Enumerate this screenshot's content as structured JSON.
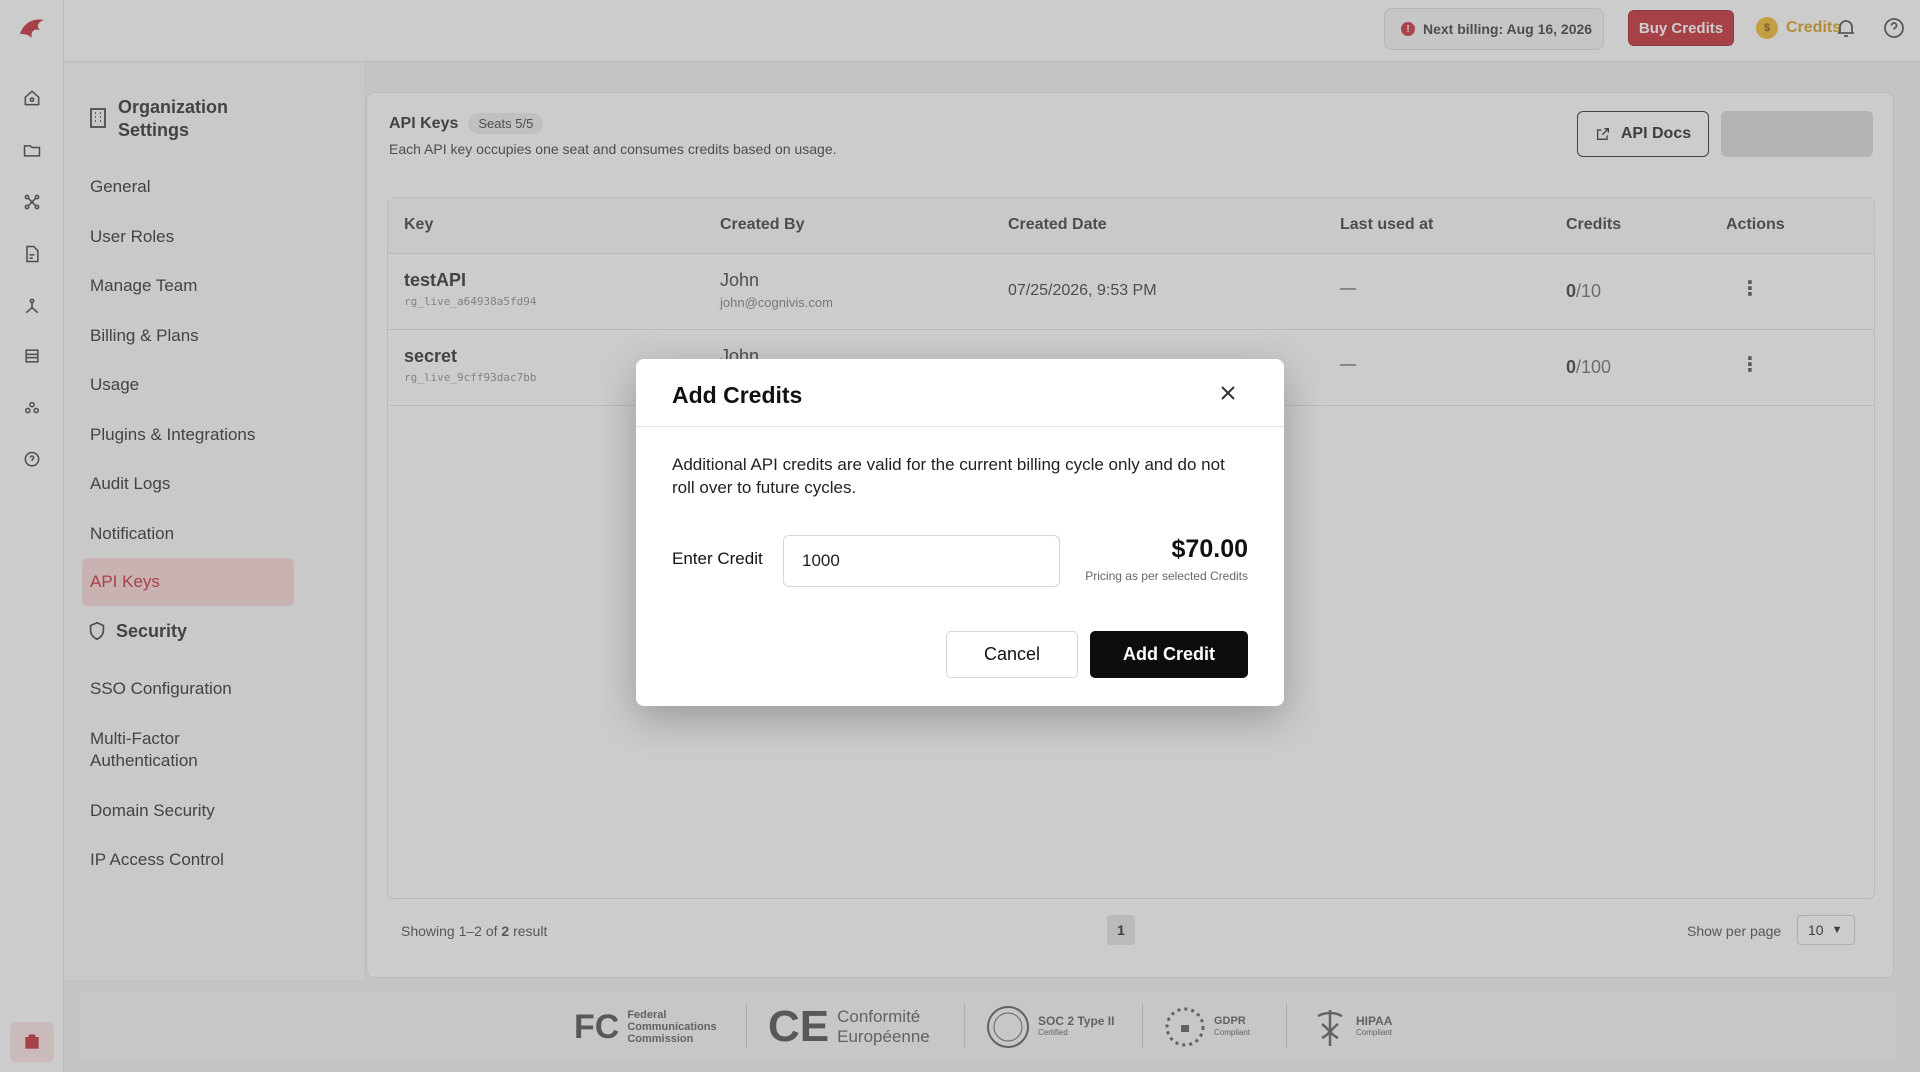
{
  "topbar": {
    "billing": "Next billing: Aug 16, 2026",
    "buy_credits": "Buy Credits",
    "credits": "Credits",
    "icons": [
      "bell-icon",
      "help-icon"
    ]
  },
  "settings_nav": {
    "title": "Organization Settings",
    "items": [
      "General",
      "User Roles",
      "Manage Team",
      "Billing & Plans",
      "Usage",
      "Plugins & Integrations",
      "Audit Logs",
      "Notification",
      "API Keys"
    ],
    "active": "API Keys",
    "security_title": "Security",
    "security_items": [
      "SSO Configuration",
      "Multi-Factor Authentication",
      "Domain Security",
      "IP Access Control"
    ]
  },
  "main": {
    "title": "API Keys",
    "seats": "Seats 5/5",
    "subtitle": "Each API key occupies one seat and consumes credits based on usage.",
    "docs_button": "API Docs",
    "columns": [
      "Key",
      "Created By",
      "Created Date",
      "Last used at",
      "Credits",
      "Actions"
    ],
    "rows": [
      {
        "name": "testAPI",
        "id": "rg_live_a64938a5fd94",
        "creator": "John",
        "email": "john@cognivis.com",
        "date": "07/25/2026, 9:53 PM",
        "last_used": "—",
        "used": "0",
        "limit": "/10"
      },
      {
        "name": "secret",
        "id": "rg_live_9cff93dac7bb",
        "creator": "John",
        "email": "",
        "date": "",
        "last_used": "—",
        "used": "0",
        "limit": "/100"
      }
    ],
    "showing": "Showing 1–2 of",
    "total": "2",
    "result": "result",
    "page": "1",
    "per_page_label": "Show per page",
    "per_page": "10"
  },
  "compliance": {
    "fcc": "Federal Communications Commission",
    "ce": "Conformité Européenne",
    "soc": "SOC 2 Type II",
    "soc_sub": "Certified",
    "gdpr": "GDPR",
    "gdpr_sub": "Compliant",
    "hipaa": "HIPAA",
    "hipaa_sub": "Compliant"
  },
  "modal": {
    "title": "Add Credits",
    "description": "Additional API credits are valid for the current billing cycle only and do not roll over to future cycles.",
    "credit_label": "Enter Credit",
    "credit_value": "1000",
    "price": "$70.00",
    "price_note": "Pricing as per selected Credits",
    "cancel": "Cancel",
    "submit": "Add Credit"
  },
  "colors": {
    "brand_red": "#c21f2a",
    "gold": "#d79a12",
    "primary_dark": "#0d0d0d"
  }
}
